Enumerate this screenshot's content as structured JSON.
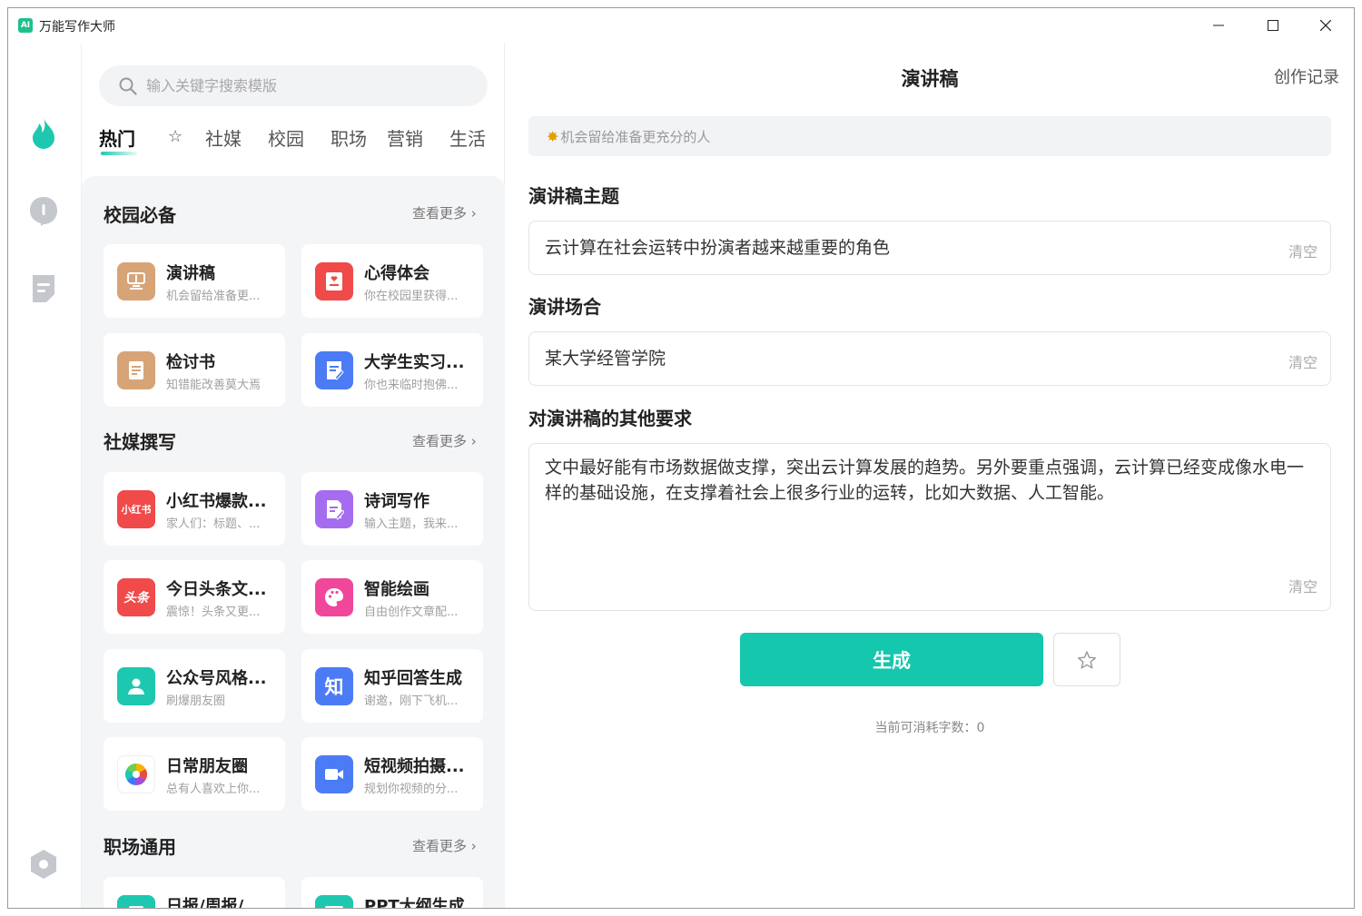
{
  "window": {
    "app_logo_text": "AI",
    "title": "万能写作大师",
    "minimize_icon": "minimize-icon",
    "maximize_icon": "maximize-icon",
    "close_icon": "close-icon"
  },
  "rail": {
    "items": [
      "fire-icon",
      "info-icon",
      "document-icon",
      "settings-icon"
    ],
    "accent": "#1ec8b0",
    "inactive": "#c4c7cc"
  },
  "search": {
    "placeholder": "输入关键字搜索模版",
    "icon": "search-icon"
  },
  "tabs": [
    "热门",
    "☆",
    "社媒",
    "校园",
    "职场",
    "营销",
    "生活"
  ],
  "sections": [
    {
      "title": "校园必备",
      "more": "查看更多",
      "cards": [
        {
          "title": "演讲稿",
          "subtitle": "机会留给准备更...",
          "icon": "lectern-icon",
          "color": "#d7a477"
        },
        {
          "title": "心得体会",
          "subtitle": "你在校园里获得...",
          "icon": "notebook-heart-icon",
          "color": "#f04a4a"
        },
        {
          "title": "检讨书",
          "subtitle": "知错能改善莫大焉",
          "icon": "paper-icon",
          "color": "#d7a477"
        },
        {
          "title": "大学生实习...",
          "subtitle": "你也来临时抱佛...",
          "icon": "edit-note-icon",
          "color": "#4b7bf5"
        }
      ]
    },
    {
      "title": "社媒撰写",
      "more": "查看更多",
      "cards": [
        {
          "title": "小红书爆款...",
          "subtitle": "家人们：标题、...",
          "icon_text": "小红书",
          "icon": "xiaohongshu-icon",
          "color": "#f04a4a"
        },
        {
          "title": "诗词写作",
          "subtitle": "输入主题，我来...",
          "icon": "pen-doc-icon",
          "color": "#a66cf0"
        },
        {
          "title": "今日头条文...",
          "subtitle": "震惊！头条又更...",
          "icon_text": "头条",
          "icon": "toutiao-icon",
          "color": "#f04a4a"
        },
        {
          "title": "智能绘画",
          "subtitle": "自由创作文章配...",
          "icon": "palette-icon",
          "color": "#f0479b"
        },
        {
          "title": "公众号风格...",
          "subtitle": "刷爆朋友圈",
          "icon": "person-icon",
          "color": "#1ec8b0"
        },
        {
          "title": "知乎回答生成",
          "subtitle": "谢邀，刚下飞机...",
          "icon_text": "知",
          "icon": "zhihu-icon",
          "color": "#4b7bf5"
        },
        {
          "title": "日常朋友圈",
          "subtitle": "总有人喜欢上你...",
          "icon": "camera-aperture-icon",
          "color": "#ffffff"
        },
        {
          "title": "短视频拍摄...",
          "subtitle": "规划你视频的分...",
          "icon": "video-camera-icon",
          "color": "#4b7bf5"
        }
      ]
    },
    {
      "title": "职场通用",
      "more": "查看更多",
      "cards": [
        {
          "title": "日报/周报/...",
          "subtitle": "",
          "icon": "report-icon",
          "color": "#1ec8b0"
        },
        {
          "title": "PPT大纲生成",
          "subtitle": "",
          "icon_text": "P",
          "icon": "ppt-icon",
          "color": "#1ec8b0"
        }
      ]
    }
  ],
  "form": {
    "title": "演讲稿",
    "history_link": "创作记录",
    "banner_emoji": "✸",
    "banner": "机会留给准备更充分的人",
    "fields": [
      {
        "label": "演讲稿主题",
        "value": "云计算在社会运转中扮演者越来越重要的角色",
        "clear": "清空"
      },
      {
        "label": "演讲场合",
        "value": "某大学经管学院",
        "clear": "清空"
      },
      {
        "label": "对演讲稿的其他要求",
        "value_lines": [
          "文中最好能有市场数据做支撑，突出云计算发展的趋势。另外要重点强调，云计算已经变成像水电一",
          "样的基础设施，在支撑着社会上很多行业的运转，比如大数据、人工智能。"
        ],
        "clear": "清空"
      }
    ],
    "generate_button": "生成",
    "favorite_icon": "star-outline-icon",
    "quota": "当前可消耗字数：0",
    "accent": "#14c7ad"
  }
}
